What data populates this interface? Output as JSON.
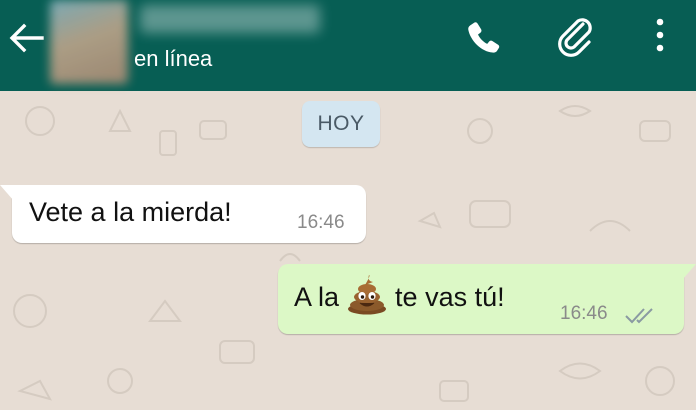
{
  "header": {
    "status": "en línea",
    "colors": {
      "bar": "#075e54",
      "icon": "#ffffff"
    },
    "icons": [
      "back-arrow-icon",
      "phone-icon",
      "paperclip-icon",
      "more-vert-icon"
    ]
  },
  "chat": {
    "date_label": "HOY",
    "colors": {
      "wallpaper": "#e7ddd4",
      "incoming": "#ffffff",
      "outgoing": "#dcf8c6",
      "date_chip": "#d4e6f1"
    },
    "messages": [
      {
        "direction": "incoming",
        "text": "Vete a la mierda!",
        "time": "16:46"
      },
      {
        "direction": "outgoing",
        "text_before": "A la",
        "emoji": "pile-of-poo-icon",
        "text_after": "te vas tú!",
        "time": "16:46",
        "status": "read-double-tick-icon"
      }
    ]
  }
}
